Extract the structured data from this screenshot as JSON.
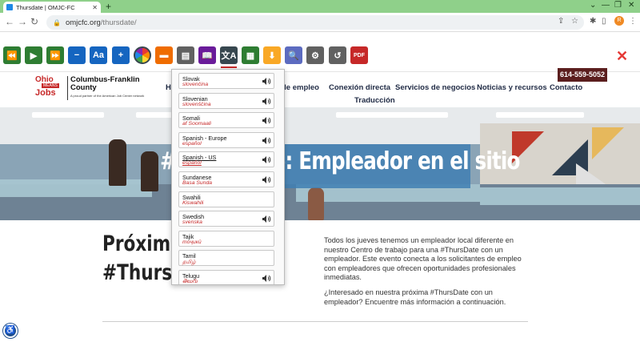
{
  "browser": {
    "tab_title": "Thursdate | OMJC-FC",
    "new_tab": "+",
    "url_host": "omjcfc.org",
    "url_path": "/thursdate/",
    "profile_initial": "R"
  },
  "toolbar": {
    "buttons": [
      {
        "name": "rewind-button",
        "color": "#2e7d32",
        "glyph": "⏪"
      },
      {
        "name": "play-button",
        "color": "#2e7d32",
        "glyph": "▶"
      },
      {
        "name": "fast-forward-button",
        "color": "#2e7d32",
        "glyph": "⏩"
      },
      {
        "name": "decrease-text-button",
        "color": "#1565c0",
        "glyph": "−"
      },
      {
        "name": "text-size-button",
        "color": "#1565c0",
        "glyph": "Aa"
      },
      {
        "name": "increase-text-button",
        "color": "#1565c0",
        "glyph": "+"
      },
      {
        "name": "color-contrast-button",
        "color": "#ffffff",
        "glyph": ""
      },
      {
        "name": "highlight-button",
        "color": "#ef6c00",
        "glyph": "▬"
      },
      {
        "name": "screen-mask-button",
        "color": "#616161",
        "glyph": "▤"
      },
      {
        "name": "dictionary-button",
        "color": "#6a1b9a",
        "glyph": "📖"
      },
      {
        "name": "translate-button",
        "color": "#37474f",
        "glyph": "文A"
      },
      {
        "name": "text-mode-button",
        "color": "#2e7d32",
        "glyph": "▦"
      },
      {
        "name": "download-mp3-button",
        "color": "#f9a825",
        "glyph": "⬇"
      },
      {
        "name": "magnifier-button",
        "color": "#5c6bc0",
        "glyph": "🔍"
      },
      {
        "name": "settings-button",
        "color": "#616161",
        "glyph": "⚙"
      },
      {
        "name": "reset-button",
        "color": "#616161",
        "glyph": "↺"
      },
      {
        "name": "pdf-button",
        "color": "#c62828",
        "glyph": "PDF"
      }
    ],
    "close_glyph": "✕"
  },
  "site": {
    "logo_ohio": "Ohio",
    "logo_means": "MEANS",
    "logo_jobs": "Jobs",
    "logo_name": "Columbus-Franklin County",
    "logo_tagline": "A proud partner of the American Job Center network",
    "nav": {
      "h": "H",
      "empleo": "de empleo",
      "conexion": "Conexión directa",
      "negocios": "Servicios de negocios",
      "noticias": "Noticias y recursos",
      "contacto": "Contacto",
      "traduccion": "Traducción"
    },
    "phone": "614-559-5052"
  },
  "hero": {
    "title": "#ThursDate: Empleador en el sitio"
  },
  "content": {
    "heading_line1": "Próximo",
    "heading_line2": "#ThursDa",
    "para1": "Todos los jueves tenemos un empleador local diferente en nuestro Centro de trabajo para una #ThursDate con un empleador. Este evento conecta a los solicitantes de empleo con empleadores que ofrecen oportunidades profesionales inmediatas.",
    "para2": "¿Interesado en nuestra próxima #ThursDate con un empleador? Encuentre más información a continuación."
  },
  "languages": [
    {
      "name": "Slovak",
      "native": "slovenčina",
      "speaker": true
    },
    {
      "name": "Slovenian",
      "native": "slovenščina",
      "speaker": true
    },
    {
      "name": "Somali",
      "native": "af Soomaali",
      "speaker": true
    },
    {
      "name": "Spanish - Europe",
      "native": "español",
      "speaker": true
    },
    {
      "name": "Spanish - US",
      "native": "español",
      "speaker": true,
      "selected": true
    },
    {
      "name": "Sundanese",
      "native": "Basa Sunda",
      "speaker": true
    },
    {
      "name": "Swahili",
      "native": "Kiswahili",
      "speaker": false
    },
    {
      "name": "Swedish",
      "native": "svenska",
      "speaker": true
    },
    {
      "name": "Tajik",
      "native": "тоҷикӣ",
      "speaker": false
    },
    {
      "name": "Tamil",
      "native": "தமிழ்",
      "speaker": false
    },
    {
      "name": "Telugu",
      "native": "తెలుగు",
      "speaker": true
    }
  ]
}
